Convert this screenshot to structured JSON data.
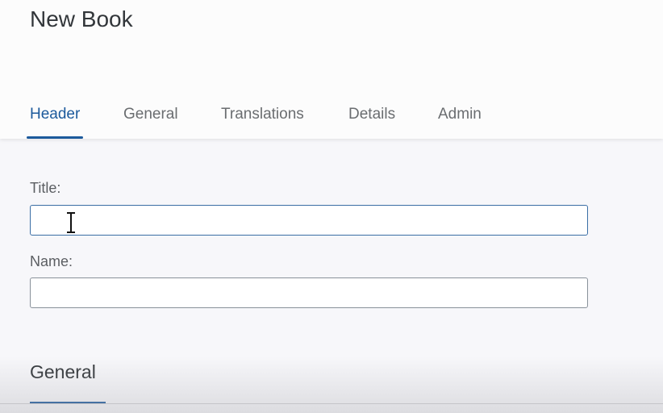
{
  "page": {
    "title": "New Book"
  },
  "tabs": [
    {
      "label": "Header",
      "active": true
    },
    {
      "label": "General",
      "active": false
    },
    {
      "label": "Translations",
      "active": false
    },
    {
      "label": "Details",
      "active": false
    },
    {
      "label": "Admin",
      "active": false
    }
  ],
  "form": {
    "title_label": "Title:",
    "title_value": "",
    "name_label": "Name:",
    "name_value": ""
  },
  "sections": {
    "general_title": "General"
  },
  "colors": {
    "accent": "#1c5a9c",
    "text": "#32363a",
    "muted": "#6a6d70"
  }
}
